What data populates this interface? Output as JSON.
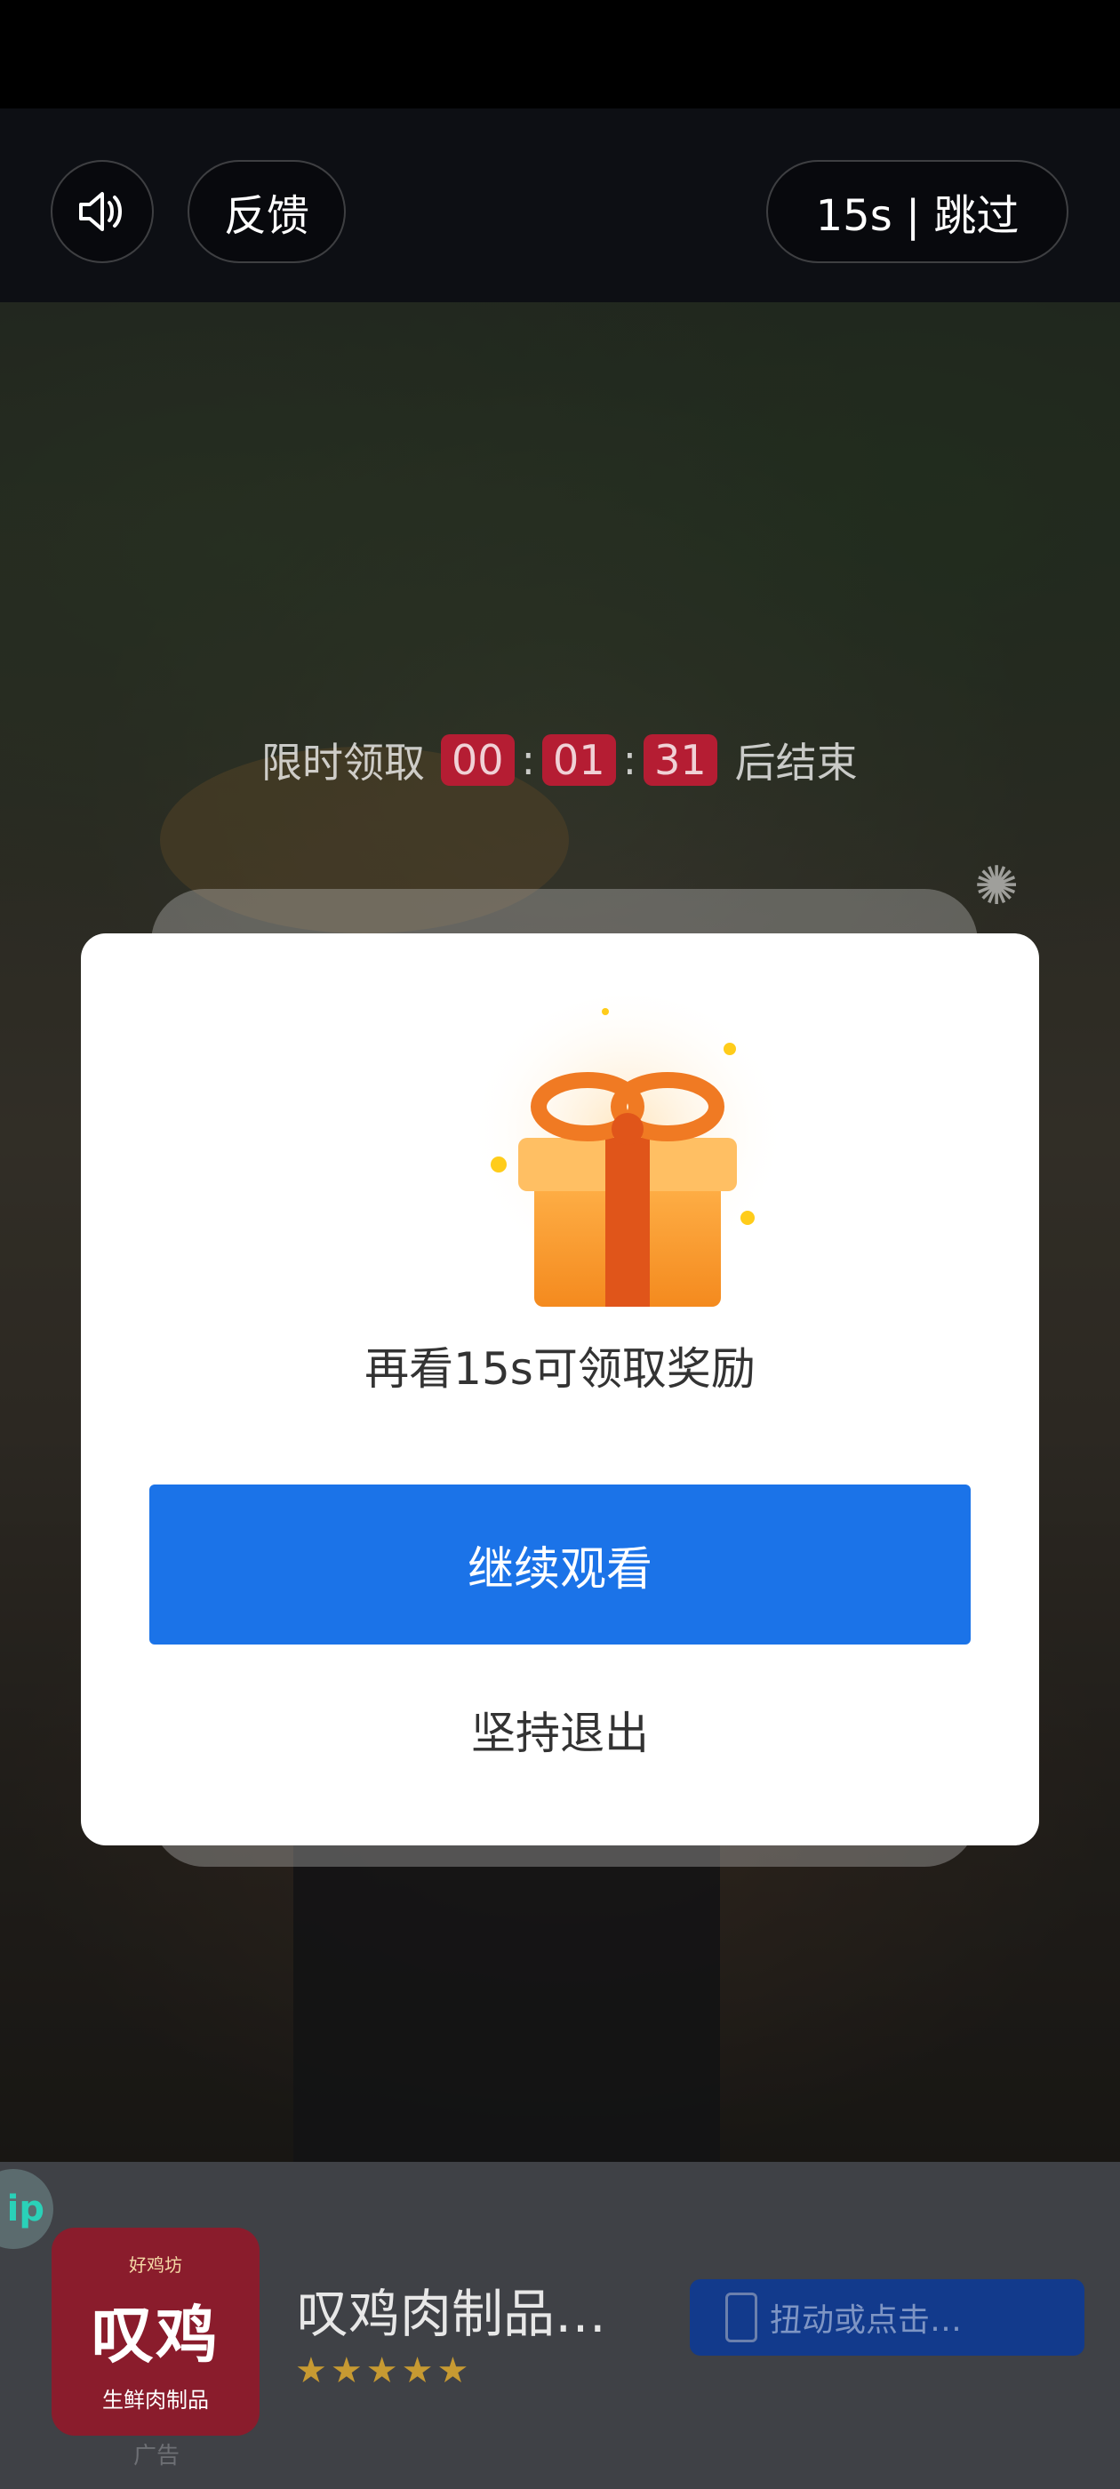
{
  "top_bar": {
    "feedback_label": "反馈",
    "skip_label": "15s | 跳过"
  },
  "countdown": {
    "prefix": "限时领取",
    "hours": "00",
    "minutes": "01",
    "seconds": "31",
    "suffix": "后结束"
  },
  "modal": {
    "message": "再看15s可领取奖励",
    "continue_label": "继续观看",
    "exit_label": "坚持退出"
  },
  "ad": {
    "side_badge": "ip",
    "logo_badge": "好鸡坊",
    "logo_name": "叹鸡",
    "logo_tagline": "生鲜肉制品",
    "title": "叹鸡肉制品…",
    "rating_stars": 5,
    "cta_label": "扭动或点击…",
    "ad_label": "广告"
  },
  "colors": {
    "primary_button": "#1b73e8",
    "countdown_digit_bg": "#b51d33",
    "star": "#c79a32"
  }
}
